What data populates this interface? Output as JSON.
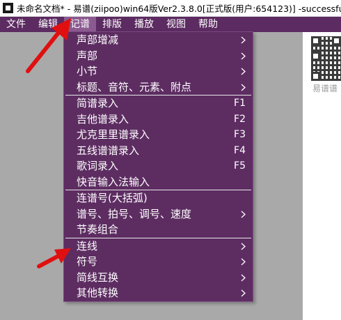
{
  "window": {
    "title": "未命名文档* - 易谱(ziipoo)win64版Ver2.3.8.0[正式版(用户:654123)] -successful(CD):F"
  },
  "menubar": {
    "items": [
      {
        "label": "文件",
        "active": false
      },
      {
        "label": "编辑",
        "active": false
      },
      {
        "label": "记谱",
        "active": true
      },
      {
        "label": "排版",
        "active": false
      },
      {
        "label": "播放",
        "active": false
      },
      {
        "label": "视图",
        "active": false
      },
      {
        "label": "帮助",
        "active": false
      }
    ]
  },
  "document": {
    "qr_caption": "易谱谱"
  },
  "dropdown": {
    "groups": [
      [
        {
          "label": "声部增减",
          "submenu": true
        },
        {
          "label": "声部",
          "submenu": true
        },
        {
          "label": "小节",
          "submenu": true
        },
        {
          "label": "标题、音符、元素、附点",
          "submenu": true
        }
      ],
      [
        {
          "label": "简谱录入",
          "shortcut": "F1"
        },
        {
          "label": "吉他谱录入",
          "shortcut": "F2"
        },
        {
          "label": "尤克里里谱录入",
          "shortcut": "F3"
        },
        {
          "label": "五线谱谱录入",
          "shortcut": "F4"
        },
        {
          "label": "歌词录入",
          "shortcut": "F5"
        },
        {
          "label": "快音输入法输入"
        }
      ],
      [
        {
          "label": "连谱号(大括弧)"
        },
        {
          "label": "谱号、拍号、调号、速度",
          "submenu": true
        },
        {
          "label": "节奏组合"
        }
      ],
      [
        {
          "label": "连线",
          "submenu": true
        },
        {
          "label": "符号",
          "submenu": true
        },
        {
          "label": "简线互换",
          "submenu": true
        },
        {
          "label": "其他转换",
          "submenu": true
        }
      ]
    ]
  },
  "colors": {
    "menu_bg": "#5d2d62",
    "menubar_bg": "#5c2b61",
    "annotation_arrow": "#e01010"
  }
}
